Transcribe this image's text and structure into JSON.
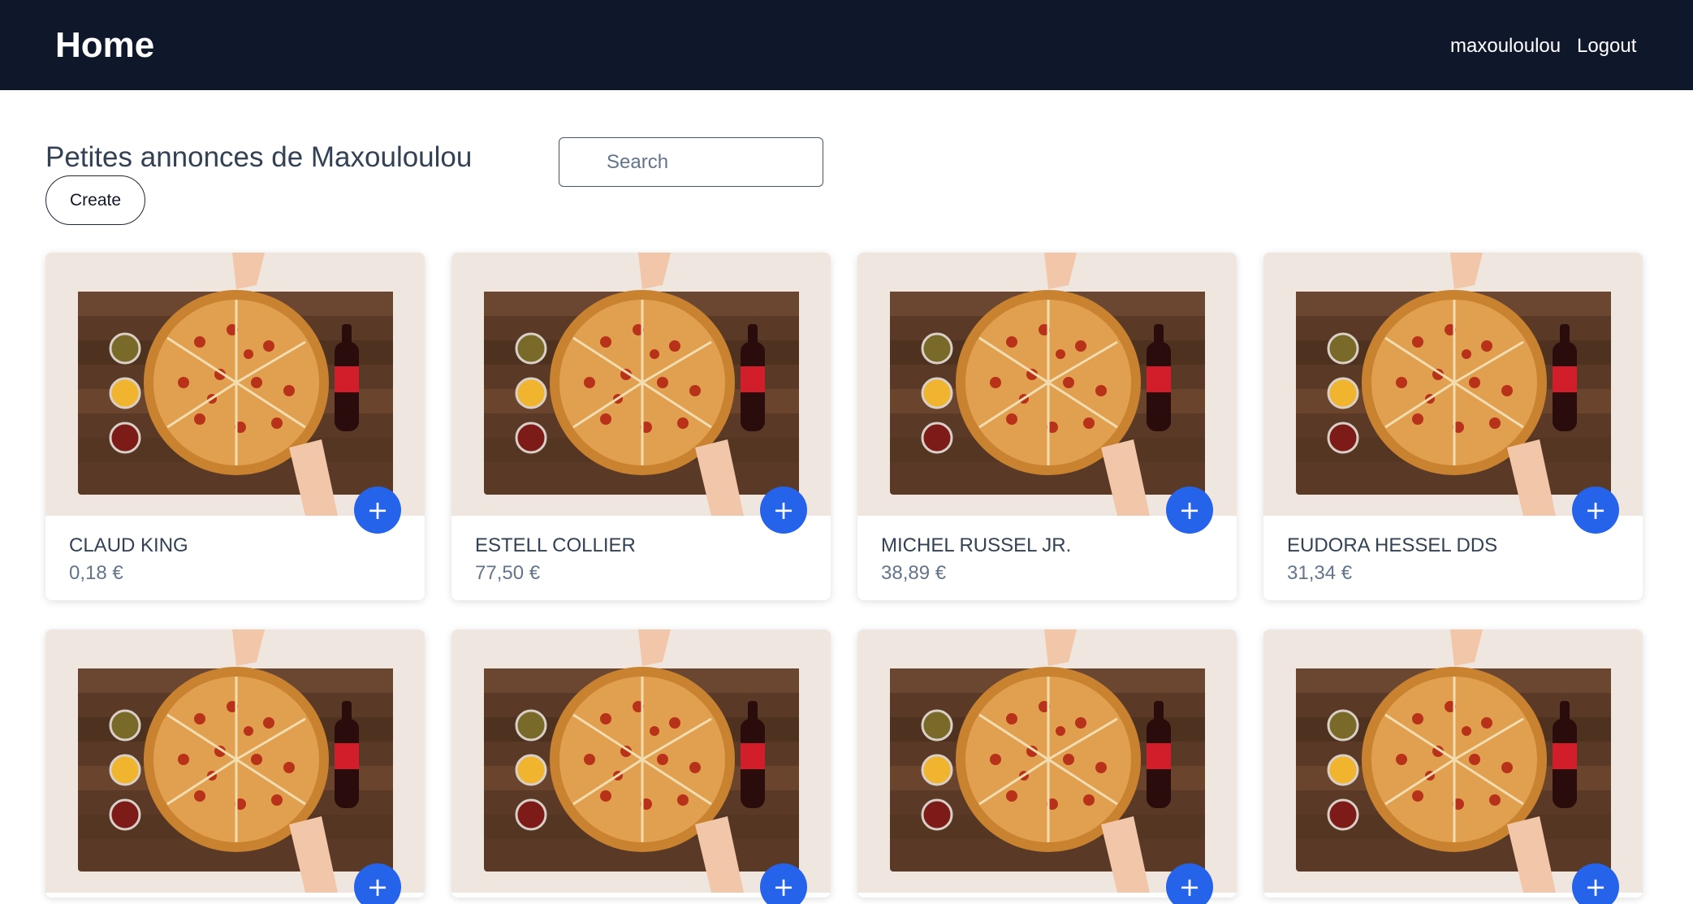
{
  "navbar": {
    "brand": "Home",
    "username": "maxouloulou",
    "logout_label": "Logout"
  },
  "main": {
    "title": "Petites annonces de Maxouloulou",
    "search_placeholder": "Search",
    "create_label": "Create"
  },
  "add_icon": "plus-icon",
  "add_label": "+",
  "colors": {
    "navbar_bg": "#0f172a",
    "accent": "#2563eb",
    "title_text": "#334155",
    "price_text": "#64748b"
  },
  "cards": [
    {
      "title": "CLAUD KING",
      "price": "0,18 €"
    },
    {
      "title": "ESTELL COLLIER",
      "price": "77,50 €"
    },
    {
      "title": "MICHEL RUSSEL JR.",
      "price": "38,89 €"
    },
    {
      "title": "EUDORA HESSEL DDS",
      "price": "31,34 €"
    },
    {
      "title": "",
      "price": ""
    },
    {
      "title": "",
      "price": ""
    },
    {
      "title": "",
      "price": ""
    },
    {
      "title": "",
      "price": ""
    }
  ]
}
